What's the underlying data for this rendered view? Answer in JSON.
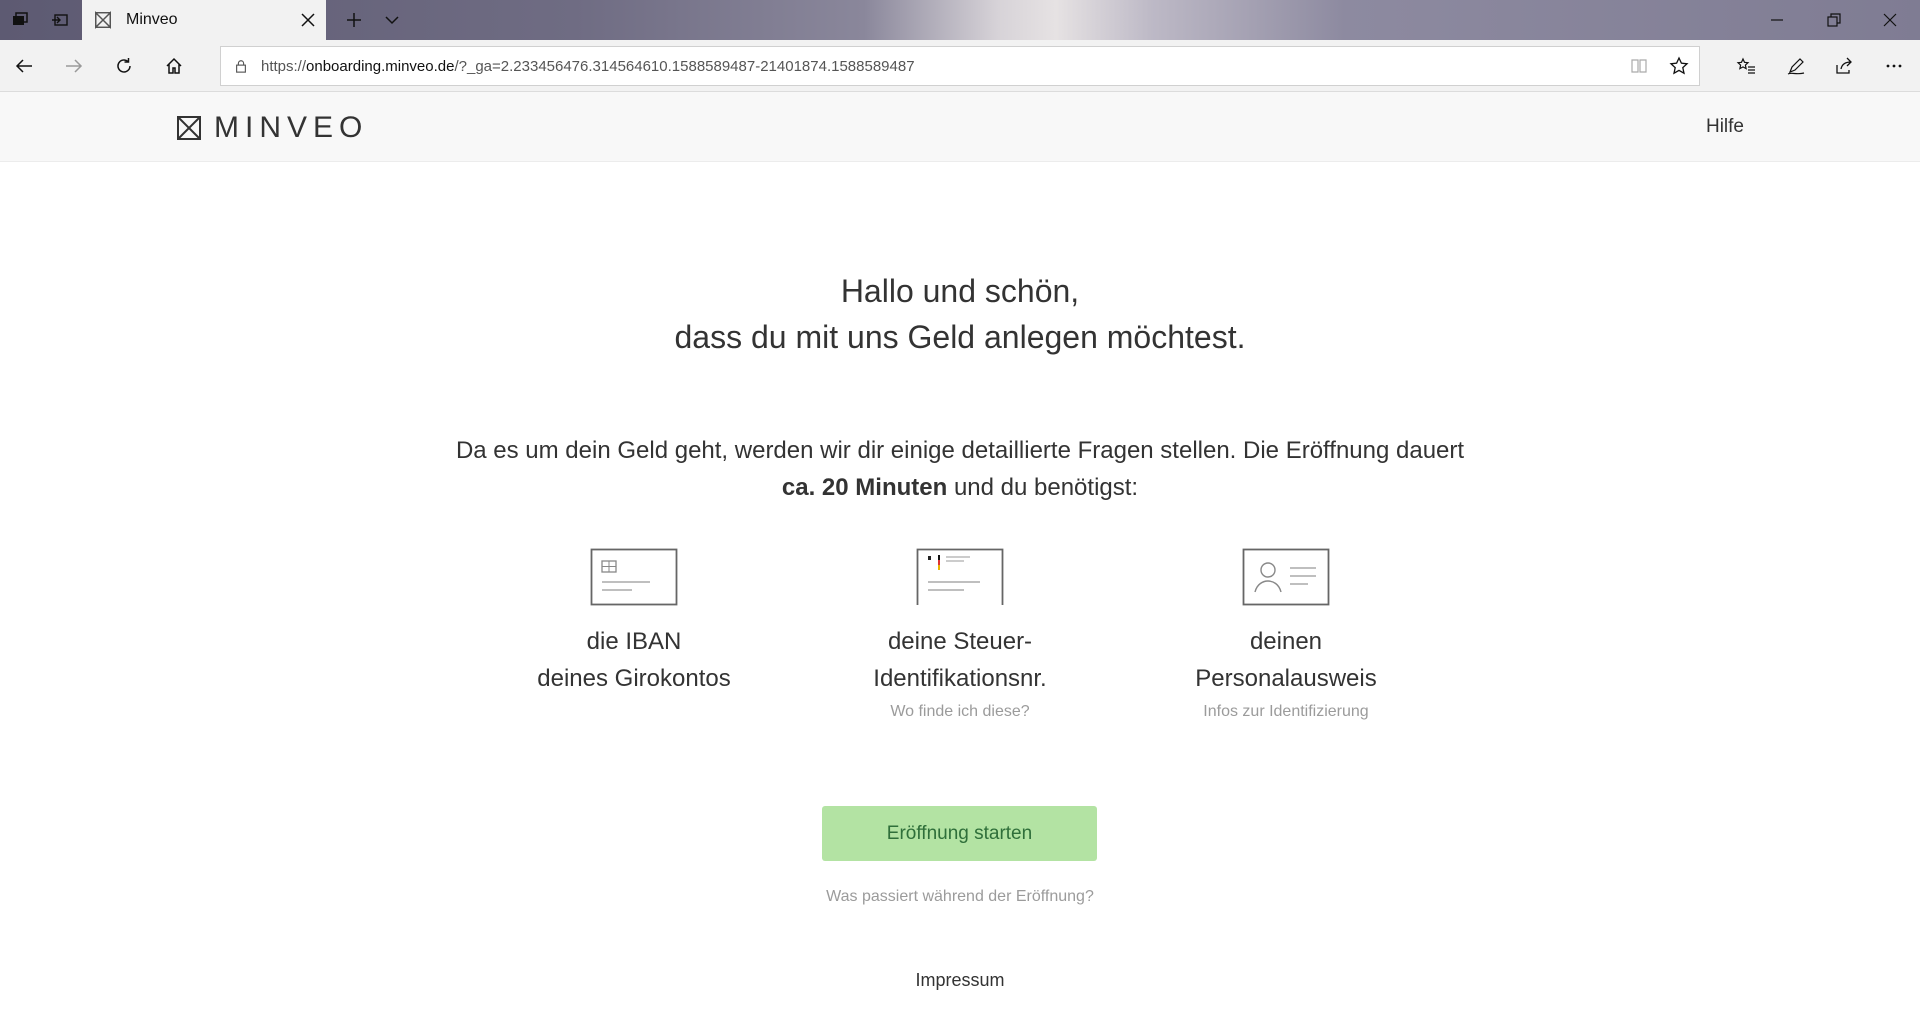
{
  "browser": {
    "tab_title": "Minveo",
    "url_prefix": "https://",
    "url_host": "onboarding.minveo.de",
    "url_rest": "/?_ga=2.233456476.314564610.1588589487-21401874.1588589487"
  },
  "header": {
    "brand": "MINVEO",
    "help_label": "Hilfe"
  },
  "main": {
    "headline_line1": "Hallo und schön,",
    "headline_line2": "dass du mit uns Geld anlegen möchtest.",
    "intro_part1": "Da es um dein Geld geht, werden wir dir einige detaillierte Fragen stellen. Die Eröffnung dauert",
    "intro_bold": "ca. 20 Minuten",
    "intro_part2": "und du benötigst:",
    "requirements": [
      {
        "line1": "die IBAN",
        "line2": "deines Girokontos",
        "link": ""
      },
      {
        "line1": "deine Steuer-",
        "line2": "Identifikationsnr.",
        "link": "Wo finde ich diese?"
      },
      {
        "line1": "deinen",
        "line2": "Personalausweis",
        "link": "Infos zur Identifizierung"
      }
    ],
    "start_button": "Eröffnung starten",
    "what_happens_link": "Was passiert während der Eröffnung?",
    "impressum": "Impressum"
  },
  "colors": {
    "button_bg": "#b3e3a3",
    "button_text": "#2f6f3a",
    "muted_text": "#9b9b9b"
  }
}
